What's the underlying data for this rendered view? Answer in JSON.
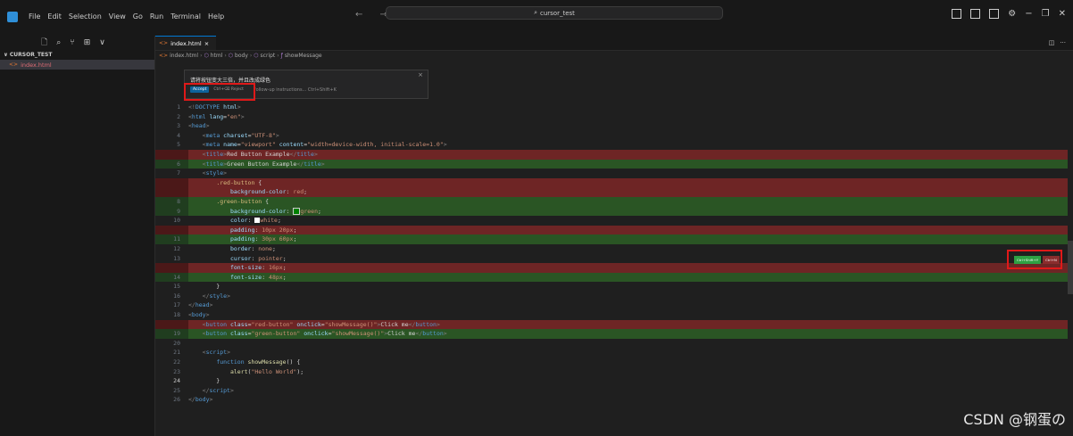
{
  "menu": [
    "File",
    "Edit",
    "Selection",
    "View",
    "Go",
    "Run",
    "Terminal",
    "Help"
  ],
  "nav_arrows": "← →",
  "search": {
    "value": "cursor_test",
    "icon": "search-icon"
  },
  "window_controls": {
    "settings": "⚙",
    "minimize": "−",
    "restore": "❐",
    "close": "✕"
  },
  "sidebar": {
    "toolbar_icons": [
      "new-file-icon",
      "search-icon",
      "source-control-icon",
      "extensions-icon",
      "chevron-down-icon"
    ],
    "toolbar_glyphs": [
      "🗋",
      "⌕",
      "⑂",
      "⊞",
      "∨"
    ],
    "section_title": "CURSOR_TEST",
    "file": "index.html"
  },
  "editor": {
    "tab_label": "index.html",
    "tab_close": "×",
    "tab_right": [
      "◫",
      "···"
    ],
    "breadcrumbs": [
      "index.html",
      "html",
      "body",
      "script",
      "showMessage"
    ],
    "ai_widget": {
      "prompt": "请将按钮变大三倍，并且改成绿色",
      "accept": "Accept",
      "reject": "Ctrl+⌫ Reject",
      "followup": "Follow-up instructions... Ctrl+Shift+K",
      "close": "×"
    },
    "diff_hint": {
      "accept": "Ctrl+Shift+Y",
      "reject": "Ctrl+N"
    },
    "code_lines": [
      {
        "n": "1",
        "kind": "",
        "html": "<span class=\"t-punct\">&lt;!</span><span class=\"t-tag\">DOCTYPE</span> <span class=\"t-attr\">html</span><span class=\"t-punct\">&gt;</span>"
      },
      {
        "n": "2",
        "kind": "",
        "html": "<span class=\"t-punct\">&lt;</span><span class=\"t-tag\">html</span> <span class=\"t-attr\">lang</span>=<span class=\"t-str\">\"en\"</span><span class=\"t-punct\">&gt;</span>"
      },
      {
        "n": "3",
        "kind": "",
        "html": "<span class=\"t-punct\">&lt;</span><span class=\"t-tag\">head</span><span class=\"t-punct\">&gt;</span>"
      },
      {
        "n": "4",
        "kind": "",
        "html": "    <span class=\"t-punct\">&lt;</span><span class=\"t-tag\">meta</span> <span class=\"t-attr\">charset</span>=<span class=\"t-str\">\"UTF-8\"</span><span class=\"t-punct\">&gt;</span>"
      },
      {
        "n": "5",
        "kind": "",
        "html": "    <span class=\"t-punct\">&lt;</span><span class=\"t-tag\">meta</span> <span class=\"t-attr\">name</span>=<span class=\"t-str\">\"viewport\"</span> <span class=\"t-attr\">content</span>=<span class=\"t-str\">\"width=device-width, initial-scale=1.0\"</span><span class=\"t-punct\">&gt;</span>"
      },
      {
        "n": "",
        "kind": "del",
        "html": "    <span class=\"t-punct\">&lt;</span><span class=\"t-tag\">title</span><span class=\"t-punct\">&gt;</span>Red Button Example<span class=\"t-punct\">&lt;/</span><span class=\"t-tag\">title</span><span class=\"t-punct\">&gt;</span>"
      },
      {
        "n": "6",
        "kind": "add",
        "html": "    <span class=\"t-punct\">&lt;</span><span class=\"t-tag\">title</span><span class=\"t-punct\">&gt;</span>Green Button Example<span class=\"t-punct\">&lt;/</span><span class=\"t-tag\">title</span><span class=\"t-punct\">&gt;</span>"
      },
      {
        "n": "7",
        "kind": "",
        "html": "    <span class=\"t-punct\">&lt;</span><span class=\"t-tag\">style</span><span class=\"t-punct\">&gt;</span>"
      },
      {
        "n": "",
        "kind": "del",
        "html": "        <span class=\"t-sel\">.red-button</span> {"
      },
      {
        "n": "",
        "kind": "del",
        "html": "            <span class=\"t-prop\">background-color</span>: <span class=\"t-str\">red</span>;"
      },
      {
        "n": "8",
        "kind": "add",
        "html": "        <span class=\"t-sel\">.green-button</span> {"
      },
      {
        "n": "9",
        "kind": "add",
        "html": "            <span class=\"t-prop\">background-color</span>: <span style=\"display:inline-block;width:6px;height:6px;border:1px solid #ccc;background:green;vertical-align:middle\"></span><span class=\"t-str\">green</span>;"
      },
      {
        "n": "10",
        "kind": "",
        "html": "            <span class=\"t-prop\">color</span>: <span style=\"display:inline-block;width:6px;height:6px;background:#fff;vertical-align:middle\"></span><span class=\"t-str\">white</span>;"
      },
      {
        "n": "",
        "kind": "del",
        "html": "            <span class=\"t-prop\">padding</span>: <span class=\"t-str\">10px 20px</span>;"
      },
      {
        "n": "11",
        "kind": "add",
        "html": "            <span class=\"t-prop\">padding</span>: <span class=\"t-str\">30px 60px</span>;"
      },
      {
        "n": "12",
        "kind": "",
        "html": "            <span class=\"t-prop\">border</span>: <span class=\"t-str\">none</span>;"
      },
      {
        "n": "13",
        "kind": "",
        "html": "            <span class=\"t-prop\">cursor</span>: <span class=\"t-str\">pointer</span>;"
      },
      {
        "n": "",
        "kind": "del",
        "html": "            <span class=\"t-prop\">font-size</span>: <span class=\"t-str\">16px</span>;"
      },
      {
        "n": "14",
        "kind": "add",
        "html": "            <span class=\"t-prop\">font-size</span>: <span class=\"t-str\">48px</span>;"
      },
      {
        "n": "15",
        "kind": "",
        "html": "        }"
      },
      {
        "n": "16",
        "kind": "",
        "html": "    <span class=\"t-punct\">&lt;/</span><span class=\"t-tag\">style</span><span class=\"t-punct\">&gt;</span>"
      },
      {
        "n": "17",
        "kind": "",
        "html": "<span class=\"t-punct\">&lt;/</span><span class=\"t-tag\">head</span><span class=\"t-punct\">&gt;</span>"
      },
      {
        "n": "18",
        "kind": "",
        "html": "<span class=\"t-punct\">&lt;</span><span class=\"t-tag\">body</span><span class=\"t-punct\">&gt;</span>"
      },
      {
        "n": "",
        "kind": "del",
        "html": "    <span class=\"t-punct\">&lt;</span><span class=\"t-tag\">button</span> <span class=\"t-attr\">class</span>=<span class=\"t-str\">\"red-button\"</span> <span class=\"t-attr\">onclick</span>=<span class=\"t-str\">\"showMessage()\"</span><span class=\"t-punct\">&gt;</span>Click me<span class=\"t-punct\">&lt;/</span><span class=\"t-tag\">button</span><span class=\"t-punct\">&gt;</span>"
      },
      {
        "n": "19",
        "kind": "add",
        "html": "    <span class=\"t-punct\">&lt;</span><span class=\"t-tag\">button</span> <span class=\"t-attr\">class</span>=<span class=\"t-str\">\"green-button\"</span> <span class=\"t-attr\">onclick</span>=<span class=\"t-str\">\"showMessage()\"</span><span class=\"t-punct\">&gt;</span>Click me<span class=\"t-punct\">&lt;/</span><span class=\"t-tag\">button</span><span class=\"t-punct\">&gt;</span>"
      },
      {
        "n": "20",
        "kind": "",
        "html": ""
      },
      {
        "n": "21",
        "kind": "",
        "html": "    <span class=\"t-punct\">&lt;</span><span class=\"t-tag\">script</span><span class=\"t-punct\">&gt;</span>"
      },
      {
        "n": "22",
        "kind": "",
        "html": "        <span class=\"t-kw\">function</span> <span class=\"t-fn\">showMessage</span>() {"
      },
      {
        "n": "23",
        "kind": "",
        "html": "            <span class=\"t-fn\">alert</span>(<span class=\"t-str\">\"Hello World\"</span>);"
      },
      {
        "n": "24",
        "kind": "cur",
        "html": "        }"
      },
      {
        "n": "25",
        "kind": "",
        "html": "    <span class=\"t-punct\">&lt;/</span><span class=\"t-tag\">script</span><span class=\"t-punct\">&gt;</span>"
      },
      {
        "n": "26",
        "kind": "",
        "html": "<span class=\"t-punct\">&lt;/</span><span class=\"t-tag\">body</span><span class=\"t-punct\">&gt;</span>"
      }
    ]
  },
  "watermark": "CSDN @钢蛋の",
  "colors": {
    "accent": "#0e639c",
    "deleted_line": "#4b1818",
    "added_line": "#203d1f",
    "annotation_box": "#e01919"
  }
}
